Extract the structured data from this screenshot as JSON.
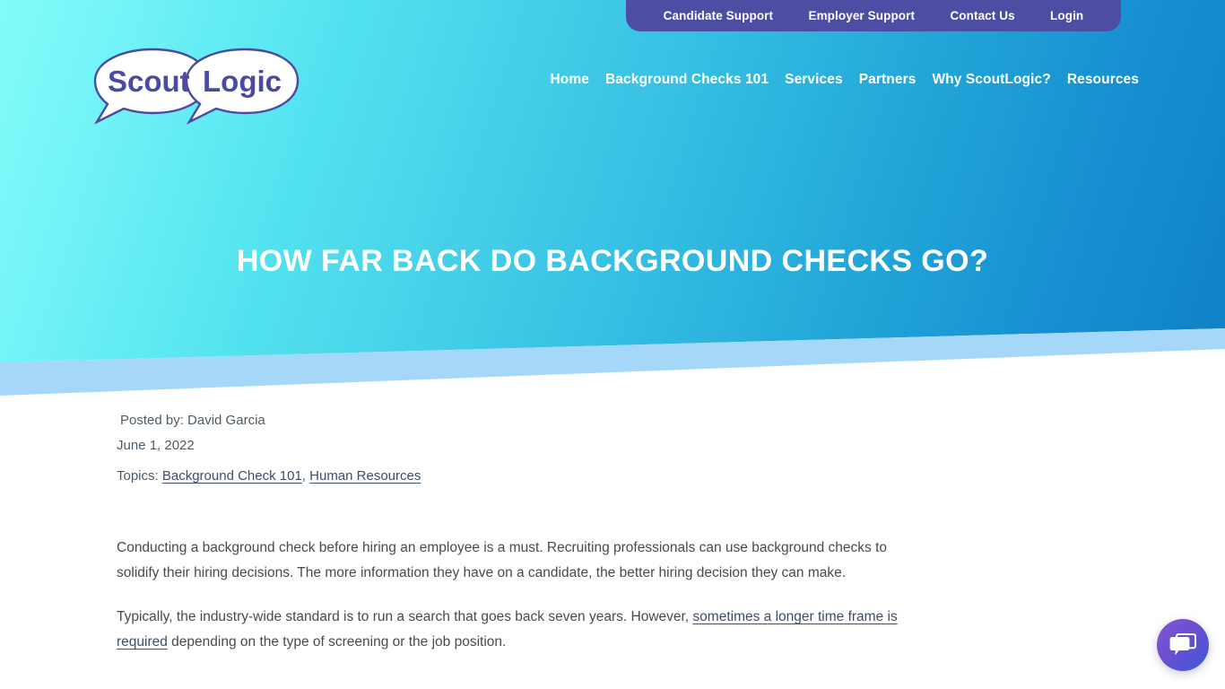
{
  "utility_nav": {
    "items": [
      {
        "label": "Candidate Support",
        "name": "utility-link-candidate-support"
      },
      {
        "label": "Employer Support",
        "name": "utility-link-employer-support"
      },
      {
        "label": "Contact Us",
        "name": "utility-link-contact-us"
      },
      {
        "label": "Login",
        "name": "utility-link-login"
      }
    ],
    "background_color": "#4d4da4"
  },
  "logo": {
    "word_one": "Scout",
    "word_two": "Logic",
    "text_color": "#4b4aa0",
    "bubble_fill": "#ffffff"
  },
  "main_nav": {
    "items": [
      {
        "label": "Home"
      },
      {
        "label": "Background Checks 101"
      },
      {
        "label": "Services"
      },
      {
        "label": "Partners"
      },
      {
        "label": "Why ScoutLogic?"
      },
      {
        "label": "Resources"
      }
    ]
  },
  "hero": {
    "title": "HOW FAR BACK DO BACKGROUND CHECKS GO?",
    "gradient_from": "#84fbfa",
    "gradient_to": "#0f80c6",
    "band_color": "#a5d8f8"
  },
  "article": {
    "posted_by": "Posted by: David Garcia",
    "date": "June 1, 2022",
    "topics_label": "Topics:",
    "topics": [
      {
        "label": "Background Check 101"
      },
      {
        "label": "Human Resources"
      }
    ],
    "topics_separator": ",",
    "paragraph_1": "Conducting a background check before hiring an employee is a must. Recruiting professionals can use background checks to solidify their hiring decisions. The more information they have on a candidate, the better hiring decision they can make.",
    "paragraph_2_part_1": "Typically, the industry-wide standard is to run a search that goes back seven years. However, ",
    "paragraph_2_link": "sometimes a longer time frame is required",
    "paragraph_2_part_2": " depending on the type of screening or the job position."
  },
  "chat_widget": {
    "icon": "chat-bubbles-icon",
    "gradient_from": "#8458d4",
    "gradient_to": "#3f57d8"
  }
}
